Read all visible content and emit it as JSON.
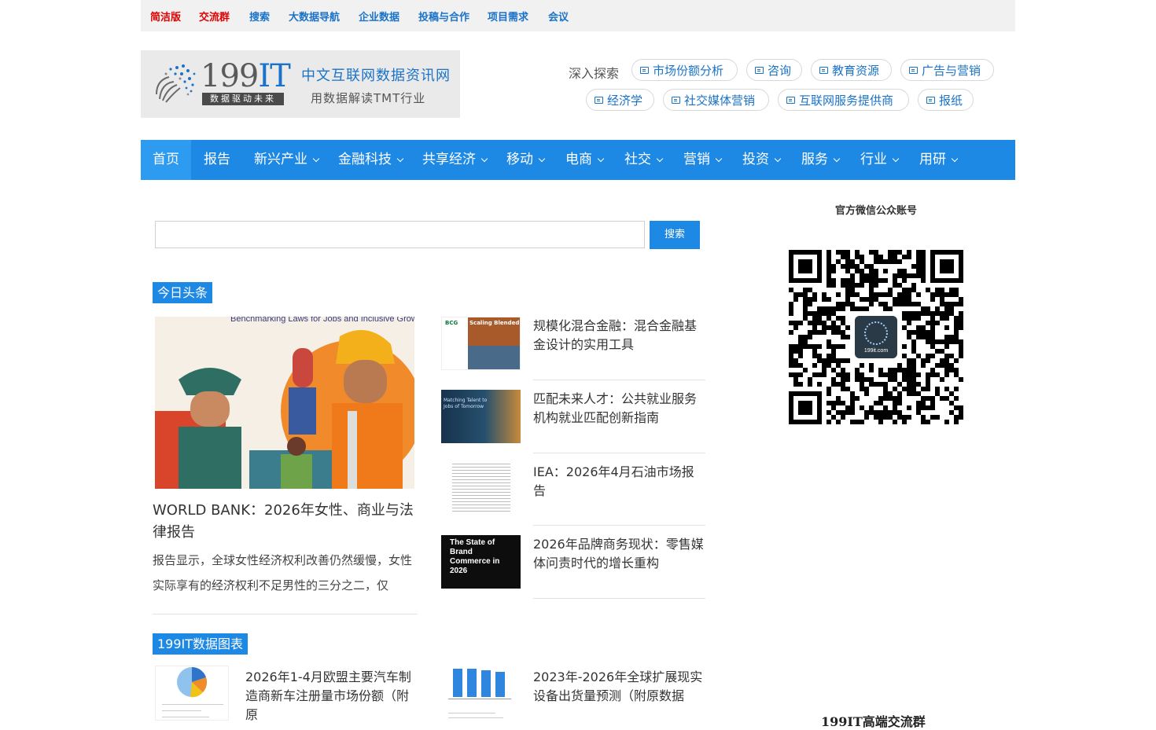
{
  "topbar": {
    "links": [
      "简洁版",
      "交流群",
      "搜索",
      "大数据导航",
      "企业数据",
      "投稿与合作",
      "项目需求",
      "会议"
    ],
    "highlight_color": "#e00000",
    "link_color": "#1a73c8"
  },
  "logo": {
    "number": "199",
    "suffix": "IT",
    "tagline": "数据驱动未来",
    "site_name": "中文互联网数据资讯网",
    "slogan": "用数据解读TMT行业"
  },
  "explore": {
    "label": "深入探索",
    "items": [
      "市场份额分析",
      "咨询",
      "教育资源",
      "广告与营销",
      "经济学",
      "社交媒体营销",
      "互联网服务提供商",
      "报纸"
    ]
  },
  "nav": {
    "items": [
      "首页",
      "报告",
      "新兴产业",
      "金融科技",
      "共享经济",
      "移动",
      "电商",
      "社交",
      "营销",
      "投资",
      "服务",
      "行业",
      "用研"
    ],
    "accent": "#1e88e5"
  },
  "search": {
    "placeholder": "",
    "button_label": "搜索"
  },
  "headlines": {
    "section_label": "今日头条",
    "feature": {
      "image_text": "Benchmarking Laws for Jobs and Inclusive Growth",
      "title": "WORLD BANK：2026年女性、商业与法律报告",
      "summary": "报告显示，全球女性经济权利改善仍然缓慢，女性实际享有的经济权利不足男性的三分之二，仅"
    },
    "items": [
      {
        "title": "规模化混合金融：混合金融基金设计的实用工具",
        "thumb_text": "Scaling Blended Finance",
        "thumb_badge": "BCG"
      },
      {
        "title": "匹配未来人才：公共就业服务机构就业匹配创新指南",
        "thumb_text": "Matching Talent to Jobs of Tomorrow"
      },
      {
        "title": "IEA：2026年4月石油市场报告",
        "thumb_text": ""
      },
      {
        "title": "2026年品牌商务现状：零售媒体问责时代的增长重构",
        "thumb_text": "The State of Brand Commerce in 2026"
      }
    ]
  },
  "charts_section": {
    "section_label": "199IT数据图表",
    "items": [
      {
        "title": "2026年1-4月欧盟主要汽车制造商新车注册量市场份额（附原"
      },
      {
        "title": "2023年-2026年全球扩展现实设备出货量预测（附原数据"
      }
    ]
  },
  "sidebar": {
    "wechat_title": "官方微信公众账号",
    "qr_center_text": "199it.com",
    "bottom_caption": "199IT高端交流群"
  }
}
